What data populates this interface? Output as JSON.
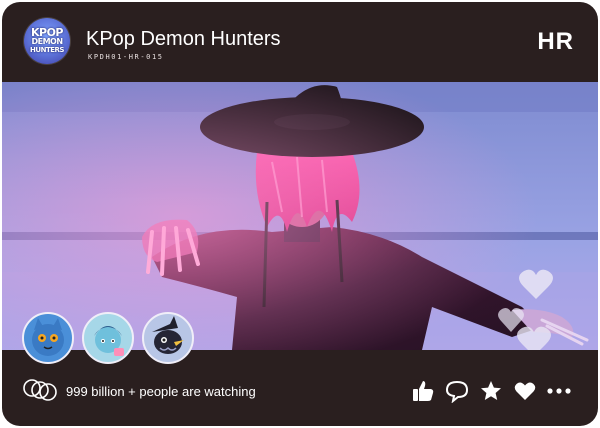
{
  "header": {
    "logo_lines": [
      "KPOP",
      "DEMON",
      "HUNTERS"
    ],
    "title": "KPop Demon Hunters",
    "code": "KPDH01-HR-015",
    "rarity": "HR"
  },
  "footer": {
    "watching_text": "999 billion + people are watching",
    "actions": [
      "thumbs-up-icon",
      "chat-icon",
      "star-icon",
      "heart-icon",
      "more-icon"
    ]
  },
  "stickers": [
    "blue-cat-sticker",
    "blue-girl-sticker",
    "black-bird-sticker"
  ],
  "colors": {
    "card_bg": "#2a1f1f",
    "accent_pink": "#ff3d8f",
    "background_blue": "#8c95d8"
  }
}
